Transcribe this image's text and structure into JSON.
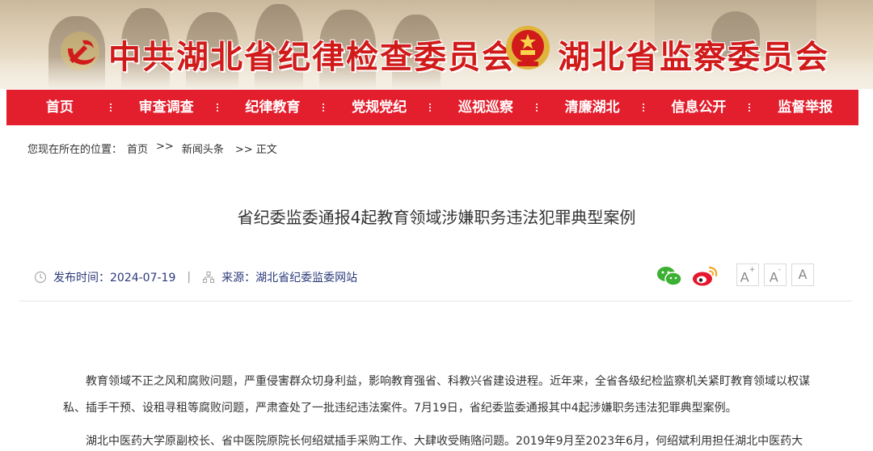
{
  "header": {
    "org_left": "中共湖北省纪律检查委员会",
    "org_right": "湖北省监察委员会",
    "accent_color": "#d11a1a"
  },
  "nav": {
    "background": "#e31e2d",
    "items": [
      {
        "label": "首页"
      },
      {
        "label": "审查调查"
      },
      {
        "label": "纪律教育"
      },
      {
        "label": "党规党纪"
      },
      {
        "label": "巡视巡察"
      },
      {
        "label": "清廉湖北"
      },
      {
        "label": "信息公开"
      },
      {
        "label": "监督举报"
      }
    ]
  },
  "breadcrumb": {
    "prefix": "您现在所在的位置：",
    "home": "首页",
    "sep": ">>",
    "section": "新闻头条",
    "current": ">> 正文"
  },
  "article": {
    "title": "省纪委监委通报4起教育领域涉嫌职务违法犯罪典型案例",
    "publish_label": "发布时间：2024-07-19",
    "divider": "|",
    "source_label": "来源：湖北省纪委监委网站",
    "paragraphs": [
      "教育领域不正之风和腐败问题，严重侵害群众切身利益，影响教育强省、科教兴省建设进程。近年来，全省各级纪检监察机关紧盯教育领域以权谋私、插手干预、设租寻租等腐败问题，严肃查处了一批违纪违法案件。7月19日，省纪委监委通报其中4起涉嫌职务违法犯罪典型案例。",
      "湖北中医药大学原副校长、省中医院原院长何绍斌插手采购工作、大肆收受贿赂问题。2019年9月至2023年6月，何绍斌利用担任湖北中医药大"
    ]
  },
  "share": {
    "wechat_icon": "wechat-icon",
    "weibo_icon": "weibo-icon"
  },
  "font_size": {
    "large": "A",
    "medium": "A",
    "small": "A",
    "plus": "+",
    "minus": "-"
  }
}
